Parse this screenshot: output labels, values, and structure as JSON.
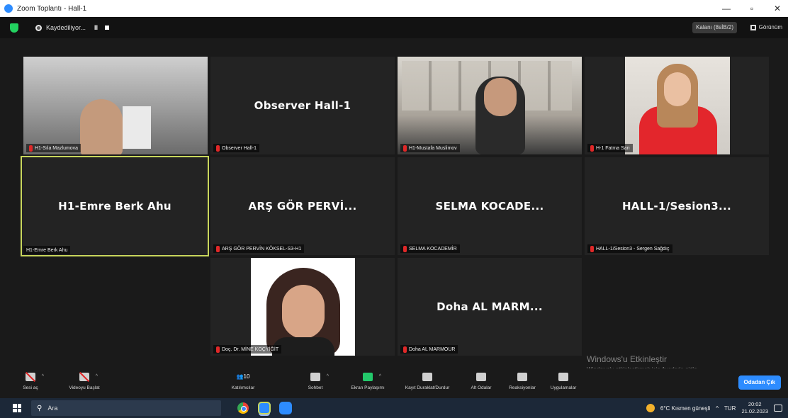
{
  "window": {
    "title": "Zoom Toplantı - Hall-1",
    "controls": {
      "minimize": "—",
      "maximize": "▫",
      "close": "✕"
    }
  },
  "topbar": {
    "recording_label": "Kaydediliyor...",
    "pause_label": "II",
    "exit_fullscreen_label": "Kalanı (8sİB/2)",
    "view_label": "Görünüm"
  },
  "tiles": [
    {
      "name": "H1-Sıla Mazlumova",
      "label": "H1-Sıla Mazlumova",
      "muted": true
    },
    {
      "name": "Observer Hall-1",
      "label": "Observer Hall-1",
      "muted": true
    },
    {
      "name": "H1-Mustafa Muslimov",
      "label": "H1-Mustafa Muslimov",
      "muted": true
    },
    {
      "name": "H-1 Fatma Sarı",
      "label": "H-1 Fatma Sarı",
      "muted": true
    },
    {
      "name": "H1-Emre Berk Ahu",
      "label": "H1-Emre Berk Ahu",
      "muted": false
    },
    {
      "name": "ARŞ GÖR PERVİ...",
      "label": "ARŞ GÖR PERVİN KÖKSEL-S3-H1",
      "muted": true
    },
    {
      "name": "SELMA KOCADE...",
      "label": "SELMA KOCADEMİR",
      "muted": true
    },
    {
      "name": "HALL-1/Sesion3...",
      "label": "HALL-1/Sesion3 - Sergen Sağdıç",
      "muted": true
    },
    {
      "name": "Doç. Dr. MİNE KOÇYİĞİT",
      "label": "Doç. Dr. MİNE KOÇYİĞİT",
      "muted": true
    },
    {
      "name": "Doha AL MARM...",
      "label": "Doha AL MARMOUR",
      "muted": true
    }
  ],
  "watermark": {
    "line1": "Windows'u Etkinleştir",
    "line2": "Windows'u etkinleştirmek için Ayarlar'a gidin."
  },
  "toolbar": {
    "items": [
      {
        "label": "Sesi aç",
        "icon": "mic-muted-icon"
      },
      {
        "label": "Videoyu Başlat",
        "icon": "camera-off-icon"
      },
      {
        "label": "Katılımcılar",
        "icon": "participants-icon",
        "count": "10"
      },
      {
        "label": "Sohbet",
        "icon": "chat-icon"
      },
      {
        "label": "Ekran Paylaşımı",
        "icon": "share-screen-icon"
      },
      {
        "label": "Kayıt Duraklat/Durdur",
        "icon": "pause-stop-icon"
      },
      {
        "label": "Alt Odalar",
        "icon": "breakout-rooms-icon"
      },
      {
        "label": "Reaksiyonlar",
        "icon": "reactions-icon"
      },
      {
        "label": "Uygulamalar",
        "icon": "apps-icon"
      }
    ],
    "end_label": "Odadan Çık"
  },
  "taskbar": {
    "search_placeholder": "Ara",
    "weather": "6°C Kısmen güneşli",
    "lang": "TUR",
    "time": "20:02",
    "date": "21.02.2023"
  },
  "colors": {
    "accent_blue": "#2d8cff",
    "muted_red": "#e02828",
    "active_speaker": "#c8d65c",
    "share_green": "#23c96b"
  }
}
